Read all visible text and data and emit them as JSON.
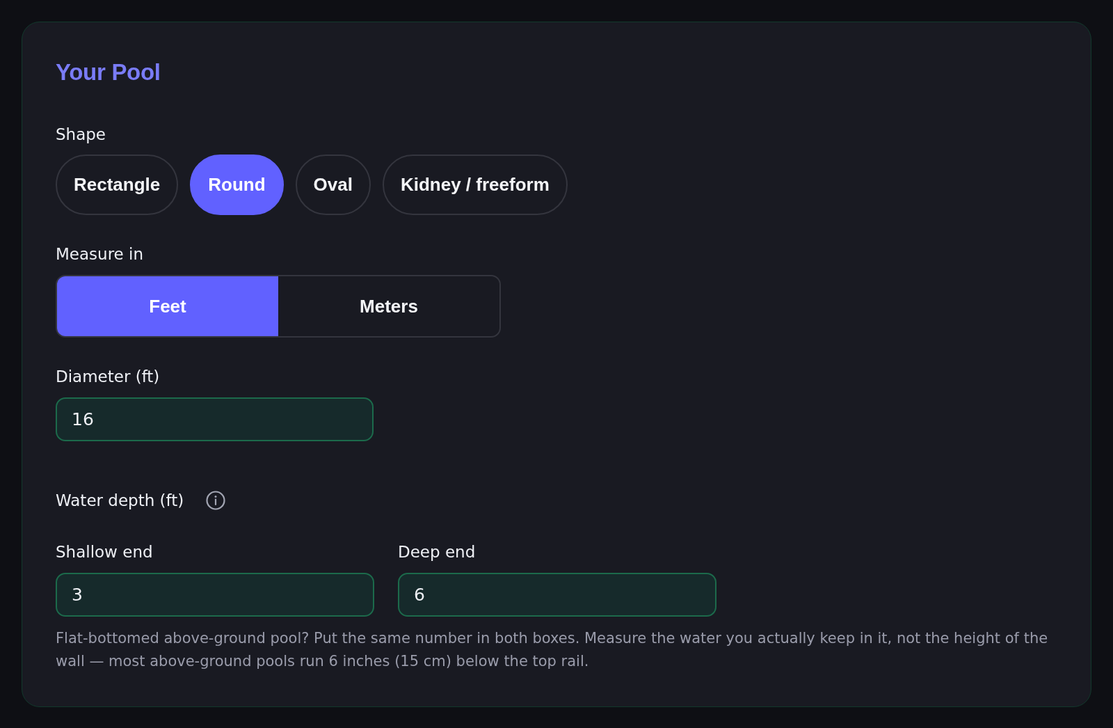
{
  "title": "Your Pool",
  "shape": {
    "label": "Shape",
    "options": [
      {
        "label": "Rectangle",
        "selected": false
      },
      {
        "label": "Round",
        "selected": true
      },
      {
        "label": "Oval",
        "selected": false
      },
      {
        "label": "Kidney / freeform",
        "selected": false
      }
    ]
  },
  "units": {
    "label": "Measure in",
    "options": [
      {
        "label": "Feet",
        "selected": true
      },
      {
        "label": "Meters",
        "selected": false
      }
    ]
  },
  "diameter": {
    "label": "Diameter (ft)",
    "value": "16"
  },
  "water_depth": {
    "label": "Water depth (ft)",
    "fields": [
      {
        "label": "Shallow end",
        "value": "3"
      },
      {
        "label": "Deep end",
        "value": "6"
      }
    ],
    "help": "Flat-bottomed above-ground pool? Put the same number in both boxes. Measure the water you actually keep in it, not the height of the wall — most above-ground pools run 6 inches (15 cm) below the top rail."
  }
}
